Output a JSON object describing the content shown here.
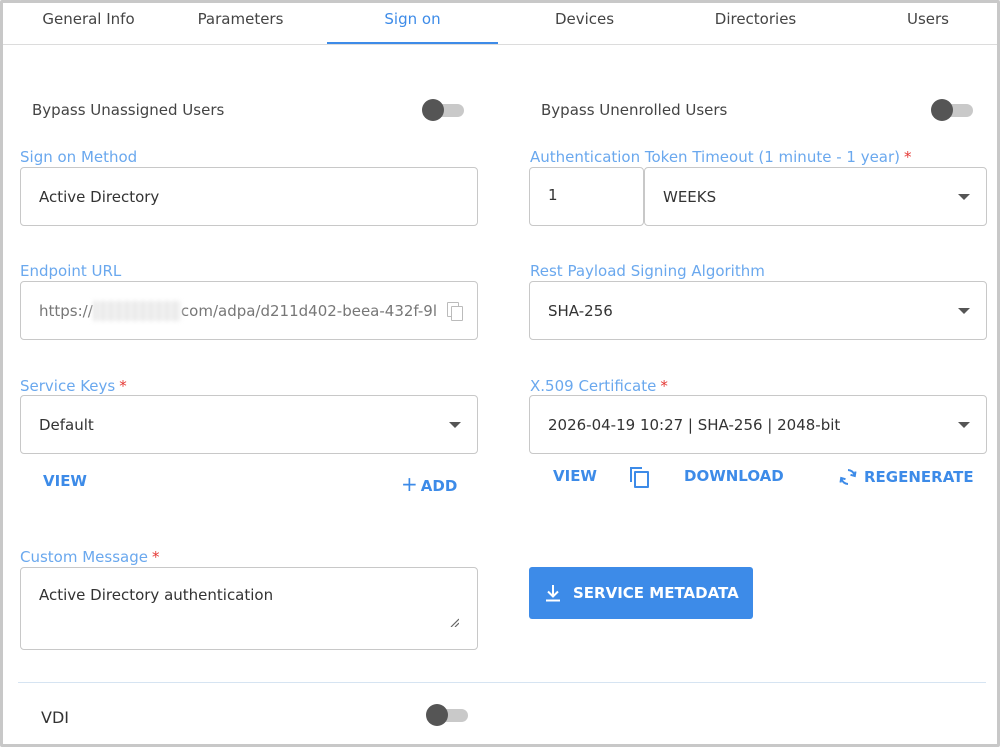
{
  "tabs": [
    {
      "label": "General Info"
    },
    {
      "label": "Parameters"
    },
    {
      "label": "Sign on"
    },
    {
      "label": "Devices"
    },
    {
      "label": "Directories"
    },
    {
      "label": "Users"
    }
  ],
  "active_tab": "Sign on",
  "toggles": {
    "bypass_unassigned": {
      "label": "Bypass Unassigned Users",
      "on": false
    },
    "bypass_unenrolled": {
      "label": "Bypass Unenrolled Users",
      "on": false
    },
    "vdi": {
      "label": "VDI",
      "on": false
    }
  },
  "sign_on_method": {
    "label": "Sign on Method",
    "value": "Active Directory"
  },
  "auth_timeout": {
    "label": "Authentication Token Timeout (1 minute - 1 year)",
    "required_mark": "*",
    "amount": "1",
    "unit": "WEEKS"
  },
  "endpoint_url": {
    "label": "Endpoint URL",
    "prefix": "https://",
    "suffix": "com/adpa/d211d402-beea-432f-9l"
  },
  "rest_payload": {
    "label": "Rest Payload Signing Algorithm",
    "value": "SHA-256"
  },
  "service_keys": {
    "label": "Service Keys",
    "required_mark": "*",
    "value": "Default",
    "view_label": "VIEW",
    "add_label": "ADD",
    "add_glyph": "+"
  },
  "certificate": {
    "label": "X.509 Certificate",
    "required_mark": "*",
    "value": "2026-04-19 10:27 | SHA-256 | 2048-bit",
    "view_label": "VIEW",
    "download_label": "DOWNLOAD",
    "regenerate_label": "REGENERATE"
  },
  "custom_message": {
    "label": "Custom Message",
    "required_mark": "*",
    "value": "Active Directory authentication"
  },
  "service_metadata_button": "SERVICE METADATA",
  "colors": {
    "accent": "#3d8be8",
    "label": "#6aa8ee",
    "required": "#e53935"
  }
}
